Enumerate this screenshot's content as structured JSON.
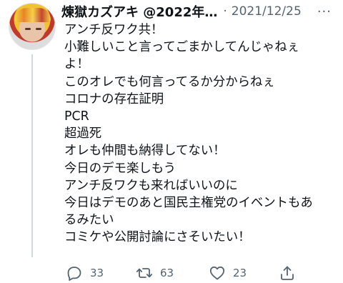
{
  "tweet": {
    "display_name": "煉獄カズアキ @2022年…",
    "separator": "·",
    "date": "2021/12/25",
    "more_label": "···",
    "lines": [
      "アンチ反ワク共！",
      "小難しいこと言ってごまかしてんじゃねぇ",
      "よ！",
      "このオレでも何言ってるか分からねぇ",
      "コロナの存在証明",
      "PCR",
      "超過死",
      "オレも仲間も納得してない！",
      "今日のデモ楽しもう",
      "アンチ反ワクも来ればいいのに",
      "今日はデモのあと国民主権党のイベントもあ",
      "るみたい",
      "コミケや公開討論にさそいたい！"
    ],
    "counts": {
      "replies": "33",
      "retweets": "63",
      "likes": "23"
    }
  },
  "icons": {
    "reply": "reply-bubble-icon",
    "retweet": "retweet-arrows-icon",
    "like": "heart-icon",
    "share": "share-upload-icon"
  },
  "colors": {
    "text": "#0f1419",
    "secondary": "#536471",
    "thread_line": "#cfd9de"
  }
}
